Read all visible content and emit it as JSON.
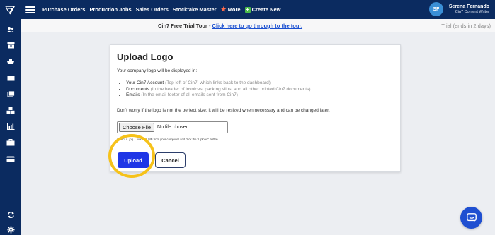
{
  "topbar": {
    "nav": [
      {
        "label": "Purchase Orders"
      },
      {
        "label": "Production Jobs"
      },
      {
        "label": "Sales Orders"
      },
      {
        "label": "Stocktake Master"
      },
      {
        "label": "More"
      },
      {
        "label": "Create New"
      }
    ],
    "user": {
      "initials": "SF",
      "name": "Serena Fernando",
      "role": "Cin7 Content Writer"
    }
  },
  "banner": {
    "prefix": "Cin7 Free Trial Tour",
    "separator": " - ",
    "link": "Click here to go through to the tour.",
    "trial_status": "Trial (ends in 2 days)"
  },
  "upload_card": {
    "title": "Upload Logo",
    "intro": "Your company logo will be displayed in:",
    "items": [
      {
        "label": "Your Cin7 Account",
        "note": "(Top left of Cin7, which links back to the dashboard)"
      },
      {
        "label": "Documents",
        "note": "(In the header of invoices, packing slips, and all other printed Cin7 documents)"
      },
      {
        "label": "Emails",
        "note": "(In the email footer of all emails sent from Cin7)"
      }
    ],
    "resize_note": "Don't worry if the logo is not the perfect size; it will be resized when necessary and can be changed later.",
    "file_input": {
      "button": "Choose File",
      "status": "No file chosen"
    },
    "help": "Select a .jpg ... under 2 MB from your computer and click the \"Upload\" button.",
    "upload_label": "Upload",
    "cancel_label": "Cancel"
  },
  "colors": {
    "navbar": "#0b2b60",
    "upload_button": "#1f36e6",
    "highlight_ring": "#f6c21a",
    "link": "#1a4fd0",
    "chat_button": "#1f4fd1"
  },
  "sidebar_icons": [
    "users-icon",
    "inventory-icon",
    "ship-icon",
    "folder-icon",
    "stack-icon",
    "boxes-icon",
    "bar-chart-icon",
    "briefcase-icon",
    "card-icon",
    "sync-icon",
    "gear-icon"
  ]
}
